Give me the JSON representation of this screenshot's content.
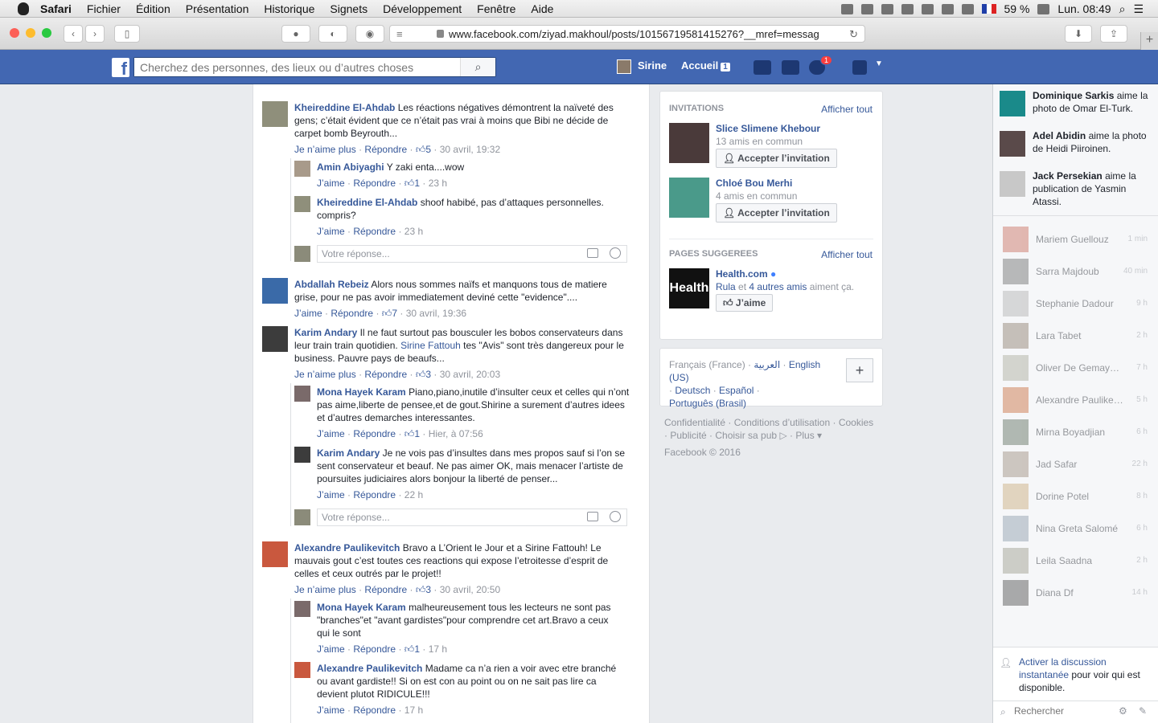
{
  "menubar": {
    "items": [
      "Safari",
      "Fichier",
      "Édition",
      "Présentation",
      "Historique",
      "Signets",
      "Développement",
      "Fenêtre",
      "Aide"
    ],
    "battery": "59 %",
    "clock": "Lun. 08:49"
  },
  "browser": {
    "url": "www.facebook.com/ziyad.makhoul/posts/10156719581415276?__mref=messag"
  },
  "fbbar": {
    "search_placeholder": "Cherchez des personnes, des lieux ou d’autres choses",
    "user_name": "Sirine",
    "home_label": "Accueil",
    "home_count": "1",
    "notif_count": "1"
  },
  "comments": [
    {
      "name": "Kheireddine El-Ahdab",
      "text": "Les réactions négatives démontrent la naïveté des gens; c’était évident que ce n’était pas vrai à moins que Bibi ne décide de carpet bomb Beyrouth...",
      "like": "Je n’aime plus",
      "reply": "Répondre",
      "count": "5",
      "time": "30 avril, 19:32"
    },
    {
      "name": "Amin Abiyaghi",
      "text": "Y zaki enta....wow",
      "like": "J’aime",
      "reply": "Répondre",
      "count": "1",
      "time": "23 h"
    },
    {
      "name": "Kheireddine El-Ahdab",
      "text": "shoof habibé, pas d’attaques personnelles. compris?",
      "like": "J’aime",
      "reply": "Répondre",
      "time": "23 h"
    },
    {
      "name": "Abdallah Rebeiz",
      "text": "Alors nous sommes naïfs et manquons tous de matiere grise, pour ne pas avoir immediatement deviné cette \"evidence\"....",
      "like": "J’aime",
      "reply": "Répondre",
      "count": "7",
      "time": "30 avril, 19:36"
    },
    {
      "name": "Karim Andary",
      "text": "Il ne faut surtout pas bousculer les bobos conservateurs dans leur train train quotidien.",
      "mention": "Sirine Fattouh",
      "text2": "tes \"Avis\" sont très dangereux pour le business. Pauvre pays de beaufs...",
      "like": "Je n’aime plus",
      "reply": "Répondre",
      "count": "3",
      "time": "30 avril, 20:03"
    },
    {
      "name": "Mona Hayek Karam",
      "text": "Piano,piano,inutile d’insulter ceux et celles qui n’ont pas aime,liberte de pensee,et de gout.Shirine a surement d’autres idees et d’autres demarches interessantes.",
      "like": "J’aime",
      "reply": "Répondre",
      "count": "1",
      "time": "Hier, à 07:56"
    },
    {
      "name": "Karim Andary",
      "text": "Je ne vois pas d’insultes dans mes propos sauf si l’on se sent conservateur et beauf. Ne pas aimer OK, mais menacer l’artiste de poursuites judiciaires alors bonjour la liberté de penser...",
      "like": "J’aime",
      "reply": "Répondre",
      "time": "22 h"
    },
    {
      "name": "Alexandre Paulikevitch",
      "text": "Bravo a L’Orient le Jour et a Sirine Fattouh! Le mauvais gout c’est toutes ces reactions qui expose l’etroitesse d’esprit de celles et ceux outrés par le projet!!",
      "like": "Je n’aime plus",
      "reply": "Répondre",
      "count": "3",
      "time": "30 avril, 20:50"
    },
    {
      "name": "Mona Hayek Karam",
      "text": "malheureusement tous les lecteurs ne sont pas \"branches\"et \"avant gardistes\"pour comprendre cet art.Bravo a ceux qui le sont",
      "like": "J’aime",
      "reply": "Répondre",
      "count": "1",
      "time": "17 h"
    },
    {
      "name": "Alexandre Paulikevitch",
      "text": "Madame ca n’a rien a voir avec etre branché ou avant gardiste!! Si on est con au point ou on ne sait pas lire ca devient plutot RIDICULE!!!",
      "like": "J’aime",
      "reply": "Répondre",
      "time": "17 h"
    }
  ],
  "reply_placeholder": "Votre réponse...",
  "invitations": {
    "title": "INVITATIONS",
    "see_all": "Afficher tout",
    "items": [
      {
        "name": "Slice Slimene Khebour",
        "mutual": "13 amis en commun",
        "button": "Accepter l’invitation"
      },
      {
        "name": "Chloé Bou Merhi",
        "mutual": "4 amis en commun",
        "button": "Accepter l’invitation"
      }
    ]
  },
  "pages": {
    "title": "PAGES SUGGEREES",
    "see_all": "Afficher tout",
    "logo_text": "Health",
    "name": "Health.com",
    "likers_a": "Rula",
    "likers_mid": "et",
    "likers_b": "4 autres amis",
    "likers_end": "aiment ça.",
    "like_button": "J’aime"
  },
  "languages": {
    "current": "Français (France)",
    "items": [
      "العربية",
      "English (US)",
      "Deutsch",
      "Español",
      "Português (Brasil)"
    ]
  },
  "footer": {
    "links": [
      "Confidentialité",
      "Conditions d’utilisation",
      "Cookies",
      "Publicité",
      "Choisir sa pub",
      "Plus"
    ],
    "copyright": "Facebook © 2016"
  },
  "ticker": [
    {
      "name": "Dominique Sarkis",
      "text": "aime la photo de Omar El-Turk."
    },
    {
      "name": "Adel Abidin",
      "text": "aime la photo de Heidi Piiroinen."
    },
    {
      "name": "Jack Persekian",
      "text": "aime la publication de Yasmin Atassi."
    }
  ],
  "chat": [
    {
      "name": "Mariem Guellouz",
      "time": "1 min"
    },
    {
      "name": "Sarra Majdoub",
      "time": "40 min"
    },
    {
      "name": "Stephanie Dadour",
      "time": "9 h"
    },
    {
      "name": "Lara Tabet",
      "time": "2 h"
    },
    {
      "name": "Oliver De Gemayzeh",
      "time": "7 h"
    },
    {
      "name": "Alexandre Paulikevi...",
      "time": "5 h"
    },
    {
      "name": "Mirna Boyadjian",
      "time": "6 h"
    },
    {
      "name": "Jad Safar",
      "time": "22 h"
    },
    {
      "name": "Dorine Potel",
      "time": "8 h"
    },
    {
      "name": "Nina Greta Salomé",
      "time": "6 h"
    },
    {
      "name": "Leila Saadna",
      "time": "2 h"
    },
    {
      "name": "Diana Df",
      "time": "14 h"
    }
  ],
  "chatfoot": {
    "activate_link": "Activer la discussion instantanée",
    "activate_rest": "pour voir qui est disponible.",
    "search_placeholder": "Rechercher"
  }
}
